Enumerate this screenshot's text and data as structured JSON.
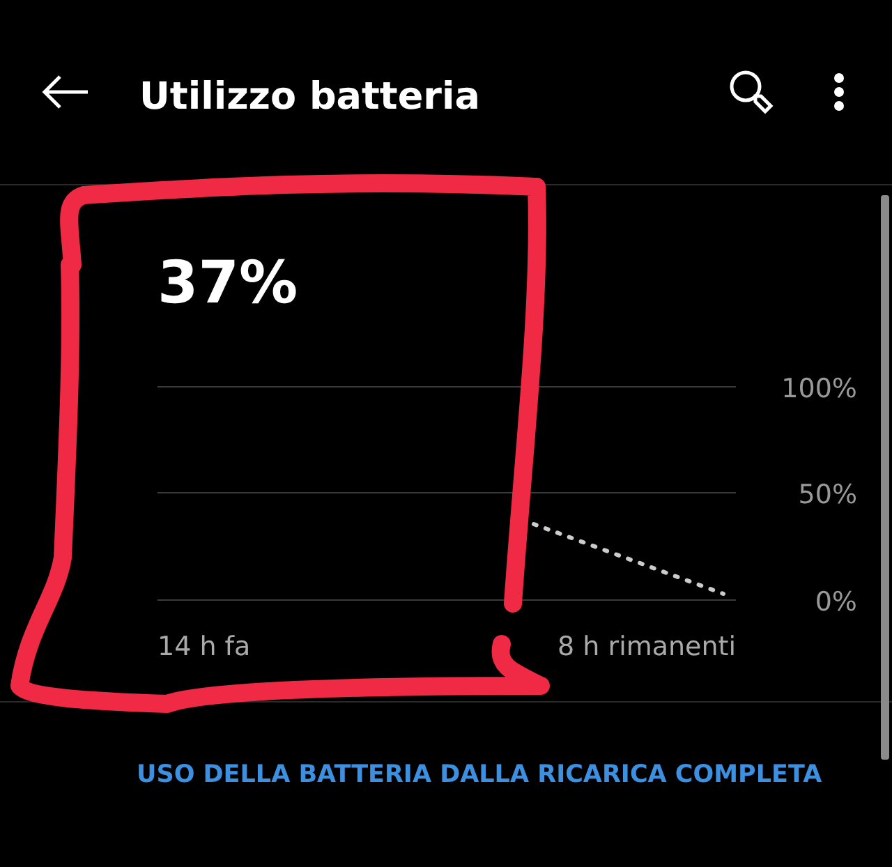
{
  "app_bar": {
    "title": "Utilizzo batteria"
  },
  "battery": {
    "percent": "37%"
  },
  "graph": {
    "y_labels": [
      "100%",
      "50%",
      "0%"
    ],
    "x_labels": [
      "14 h fa",
      "8 h rimanenti"
    ]
  },
  "section_link": "USO DELLA BATTERIA DALLA RICARICA COMPLETA",
  "annotation": {
    "kind": "scribble"
  }
}
